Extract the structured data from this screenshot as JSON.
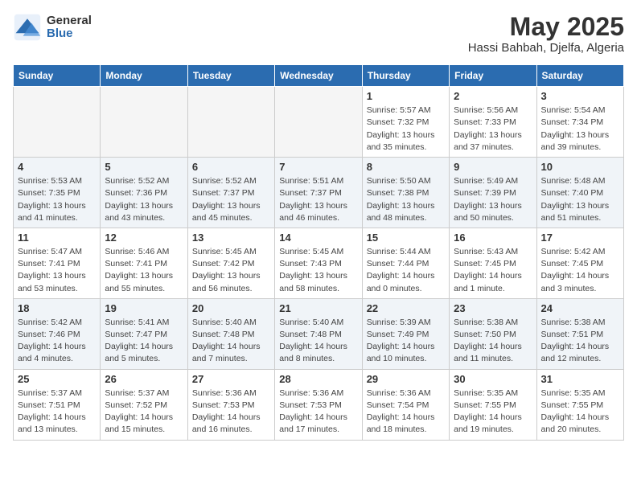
{
  "logo": {
    "general": "General",
    "blue": "Blue"
  },
  "title": "May 2025",
  "location": "Hassi Bahbah, Djelfa, Algeria",
  "weekdays": [
    "Sunday",
    "Monday",
    "Tuesday",
    "Wednesday",
    "Thursday",
    "Friday",
    "Saturday"
  ],
  "weeks": [
    [
      {
        "day": "",
        "detail": ""
      },
      {
        "day": "",
        "detail": ""
      },
      {
        "day": "",
        "detail": ""
      },
      {
        "day": "",
        "detail": ""
      },
      {
        "day": "1",
        "detail": "Sunrise: 5:57 AM\nSunset: 7:32 PM\nDaylight: 13 hours\nand 35 minutes."
      },
      {
        "day": "2",
        "detail": "Sunrise: 5:56 AM\nSunset: 7:33 PM\nDaylight: 13 hours\nand 37 minutes."
      },
      {
        "day": "3",
        "detail": "Sunrise: 5:54 AM\nSunset: 7:34 PM\nDaylight: 13 hours\nand 39 minutes."
      }
    ],
    [
      {
        "day": "4",
        "detail": "Sunrise: 5:53 AM\nSunset: 7:35 PM\nDaylight: 13 hours\nand 41 minutes."
      },
      {
        "day": "5",
        "detail": "Sunrise: 5:52 AM\nSunset: 7:36 PM\nDaylight: 13 hours\nand 43 minutes."
      },
      {
        "day": "6",
        "detail": "Sunrise: 5:52 AM\nSunset: 7:37 PM\nDaylight: 13 hours\nand 45 minutes."
      },
      {
        "day": "7",
        "detail": "Sunrise: 5:51 AM\nSunset: 7:37 PM\nDaylight: 13 hours\nand 46 minutes."
      },
      {
        "day": "8",
        "detail": "Sunrise: 5:50 AM\nSunset: 7:38 PM\nDaylight: 13 hours\nand 48 minutes."
      },
      {
        "day": "9",
        "detail": "Sunrise: 5:49 AM\nSunset: 7:39 PM\nDaylight: 13 hours\nand 50 minutes."
      },
      {
        "day": "10",
        "detail": "Sunrise: 5:48 AM\nSunset: 7:40 PM\nDaylight: 13 hours\nand 51 minutes."
      }
    ],
    [
      {
        "day": "11",
        "detail": "Sunrise: 5:47 AM\nSunset: 7:41 PM\nDaylight: 13 hours\nand 53 minutes."
      },
      {
        "day": "12",
        "detail": "Sunrise: 5:46 AM\nSunset: 7:41 PM\nDaylight: 13 hours\nand 55 minutes."
      },
      {
        "day": "13",
        "detail": "Sunrise: 5:45 AM\nSunset: 7:42 PM\nDaylight: 13 hours\nand 56 minutes."
      },
      {
        "day": "14",
        "detail": "Sunrise: 5:45 AM\nSunset: 7:43 PM\nDaylight: 13 hours\nand 58 minutes."
      },
      {
        "day": "15",
        "detail": "Sunrise: 5:44 AM\nSunset: 7:44 PM\nDaylight: 14 hours\nand 0 minutes."
      },
      {
        "day": "16",
        "detail": "Sunrise: 5:43 AM\nSunset: 7:45 PM\nDaylight: 14 hours\nand 1 minute."
      },
      {
        "day": "17",
        "detail": "Sunrise: 5:42 AM\nSunset: 7:45 PM\nDaylight: 14 hours\nand 3 minutes."
      }
    ],
    [
      {
        "day": "18",
        "detail": "Sunrise: 5:42 AM\nSunset: 7:46 PM\nDaylight: 14 hours\nand 4 minutes."
      },
      {
        "day": "19",
        "detail": "Sunrise: 5:41 AM\nSunset: 7:47 PM\nDaylight: 14 hours\nand 5 minutes."
      },
      {
        "day": "20",
        "detail": "Sunrise: 5:40 AM\nSunset: 7:48 PM\nDaylight: 14 hours\nand 7 minutes."
      },
      {
        "day": "21",
        "detail": "Sunrise: 5:40 AM\nSunset: 7:48 PM\nDaylight: 14 hours\nand 8 minutes."
      },
      {
        "day": "22",
        "detail": "Sunrise: 5:39 AM\nSunset: 7:49 PM\nDaylight: 14 hours\nand 10 minutes."
      },
      {
        "day": "23",
        "detail": "Sunrise: 5:38 AM\nSunset: 7:50 PM\nDaylight: 14 hours\nand 11 minutes."
      },
      {
        "day": "24",
        "detail": "Sunrise: 5:38 AM\nSunset: 7:51 PM\nDaylight: 14 hours\nand 12 minutes."
      }
    ],
    [
      {
        "day": "25",
        "detail": "Sunrise: 5:37 AM\nSunset: 7:51 PM\nDaylight: 14 hours\nand 13 minutes."
      },
      {
        "day": "26",
        "detail": "Sunrise: 5:37 AM\nSunset: 7:52 PM\nDaylight: 14 hours\nand 15 minutes."
      },
      {
        "day": "27",
        "detail": "Sunrise: 5:36 AM\nSunset: 7:53 PM\nDaylight: 14 hours\nand 16 minutes."
      },
      {
        "day": "28",
        "detail": "Sunrise: 5:36 AM\nSunset: 7:53 PM\nDaylight: 14 hours\nand 17 minutes."
      },
      {
        "day": "29",
        "detail": "Sunrise: 5:36 AM\nSunset: 7:54 PM\nDaylight: 14 hours\nand 18 minutes."
      },
      {
        "day": "30",
        "detail": "Sunrise: 5:35 AM\nSunset: 7:55 PM\nDaylight: 14 hours\nand 19 minutes."
      },
      {
        "day": "31",
        "detail": "Sunrise: 5:35 AM\nSunset: 7:55 PM\nDaylight: 14 hours\nand 20 minutes."
      }
    ]
  ]
}
